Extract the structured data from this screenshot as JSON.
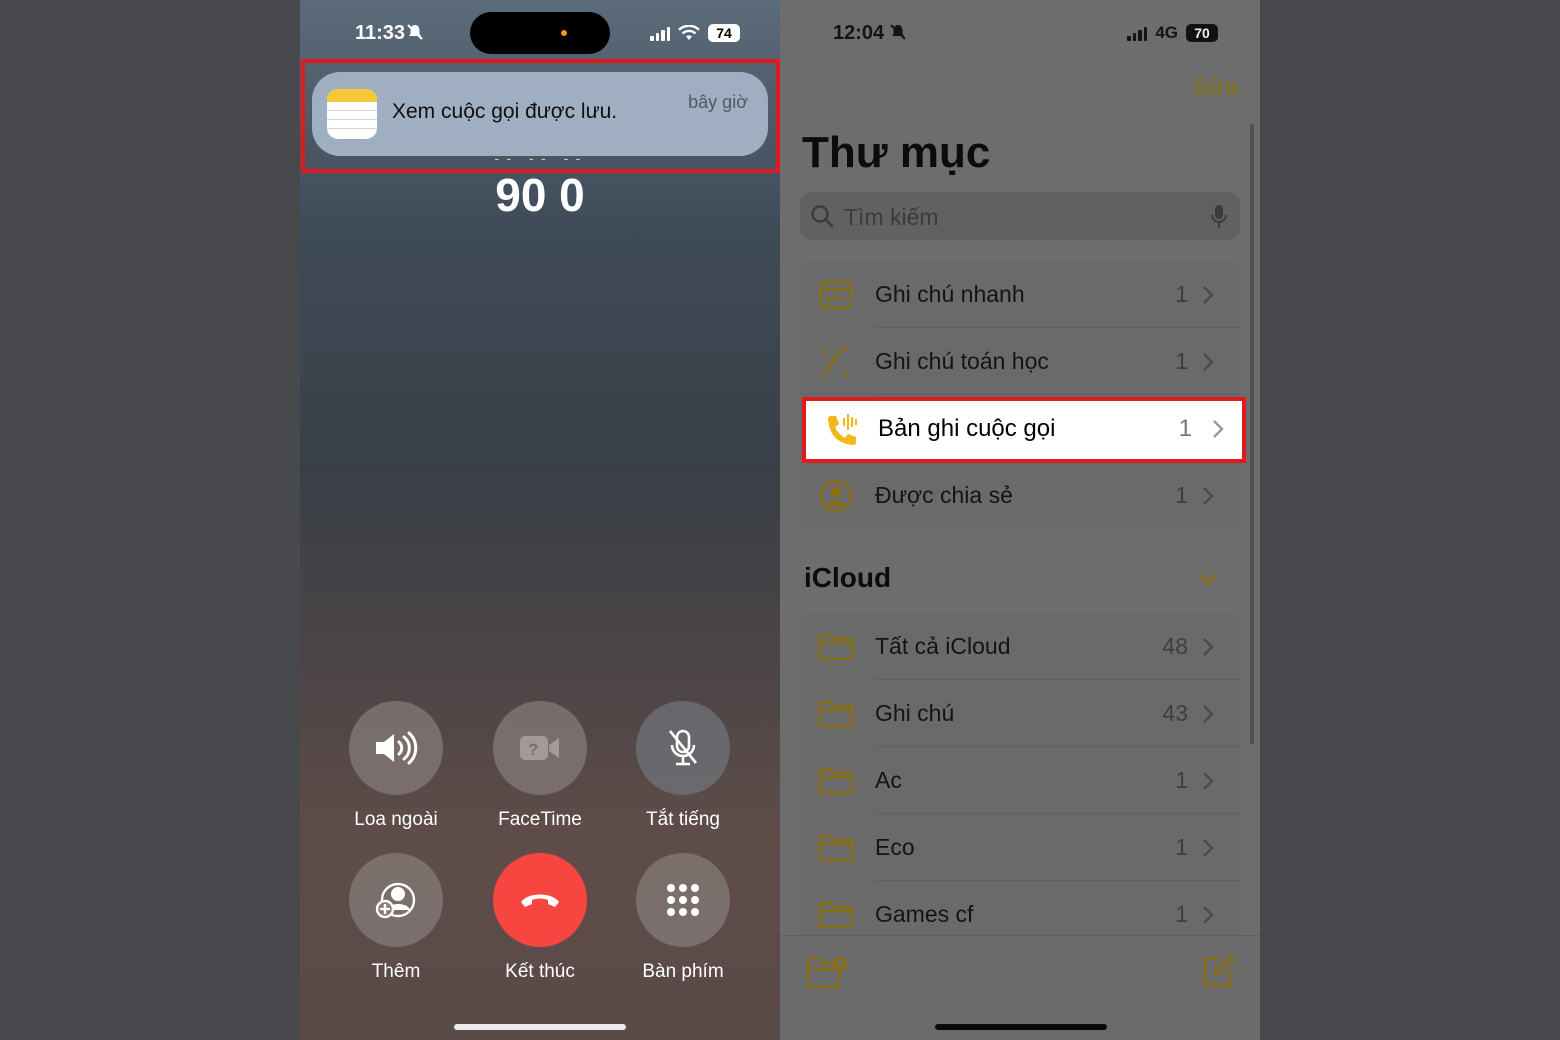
{
  "left_screen": {
    "status": {
      "time": "11:33",
      "battery": "74"
    },
    "notification": {
      "text": "Xem cuộc gọi được lưu.",
      "time": "bây giờ"
    },
    "caller_number": "90 0",
    "controls": {
      "speaker": "Loa ngoài",
      "facetime": "FaceTime",
      "mute": "Tắt tiếng",
      "add": "Thêm",
      "end": "Kết thúc",
      "keypad": "Bàn phím"
    },
    "colors": {
      "end_call": "#f7463f",
      "highlight": "#e01a1f"
    }
  },
  "right_screen": {
    "status": {
      "time": "12:04",
      "network": "4G",
      "battery": "70"
    },
    "edit_label": "Sửa",
    "title": "Thư mục",
    "search": {
      "placeholder": "Tìm kiếm"
    },
    "smart_folders": [
      {
        "name": "Ghi chú nhanh",
        "count": "1",
        "icon": "quick-note-icon"
      },
      {
        "name": "Ghi chú toán học",
        "count": "1",
        "icon": "math-notes-icon"
      },
      {
        "name": "Bản ghi cuộc gọi",
        "count": "1",
        "icon": "call-recording-icon"
      },
      {
        "name": "Được chia sẻ",
        "count": "1",
        "icon": "shared-icon"
      }
    ],
    "icloud": {
      "label": "iCloud",
      "folders": [
        {
          "name": "Tất cả iCloud",
          "count": "48"
        },
        {
          "name": "Ghi chú",
          "count": "43"
        },
        {
          "name": "Ac",
          "count": "1"
        },
        {
          "name": "Eco",
          "count": "1"
        },
        {
          "name": "Games cf",
          "count": "1"
        }
      ]
    },
    "accent_color": "#f2b81a"
  }
}
